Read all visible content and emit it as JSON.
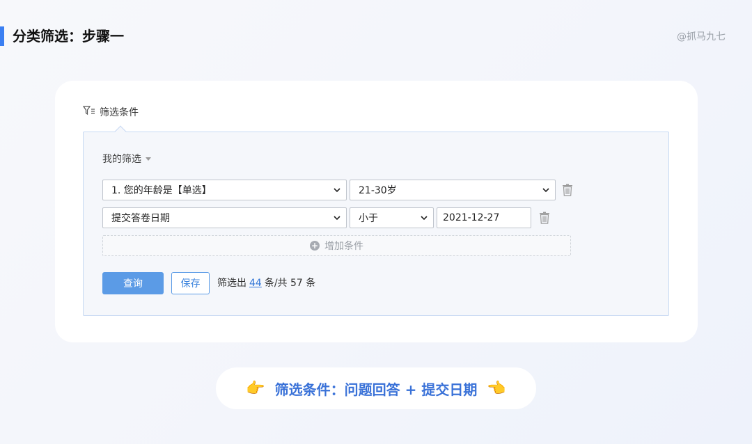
{
  "header": {
    "title": "分类筛选：步骤一",
    "author": "@抓马九七"
  },
  "filter": {
    "section_label": "筛选条件",
    "my_filter_label": "我的筛选",
    "conditions": [
      {
        "field": "1. 您的年龄是【单选】",
        "value": "21-30岁"
      },
      {
        "field": "提交答卷日期",
        "operator": "小于",
        "value": "2021-12-27"
      }
    ],
    "add_condition_label": "增加条件",
    "query_label": "查询",
    "save_label": "保存",
    "result_prefix": "筛选出",
    "result_count": "44",
    "result_suffix": "条/共 57 条"
  },
  "caption": {
    "text": "筛选条件：问题回答 + 提交日期",
    "left_hand": "👉",
    "right_hand": "👈"
  },
  "colors": {
    "accent": "#3b7ff2",
    "button_primary": "#5b9be6",
    "link": "#2f74d6",
    "panel_border": "#c7d9f3"
  },
  "icons": [
    "filter-icon",
    "chevron-down-icon",
    "trash-icon",
    "plus-circle-icon",
    "pointing-right-hand-icon",
    "pointing-left-hand-icon"
  ]
}
